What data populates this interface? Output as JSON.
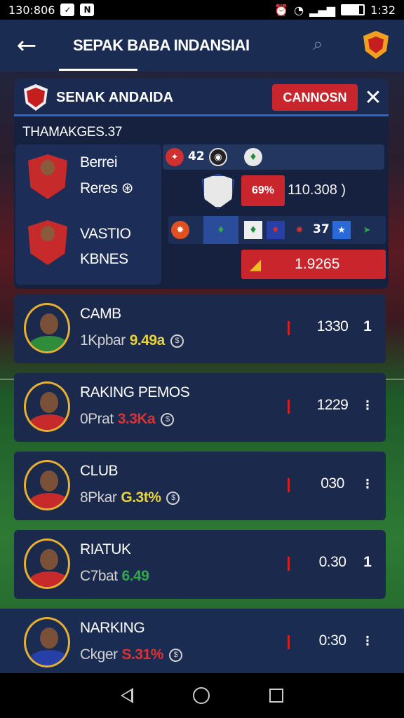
{
  "status": {
    "left_text": "130:806",
    "time": "1:32"
  },
  "app": {
    "title": "SEPAK BABA INDANSIAI"
  },
  "panel": {
    "title": "SENAK ANDAIDA",
    "button_label": "CANNOSN",
    "subtitle": "THAMAKGES.37",
    "players": [
      {
        "name": "Berrei"
      },
      {
        "name": "Reres"
      },
      {
        "name": "VASTIO"
      },
      {
        "name": "KBNES"
      }
    ],
    "row1_badge_text": "42",
    "odds_pct": "69%",
    "odds_value": "110.308 )",
    "row3_badge_text": "37",
    "big_value": "1.9265"
  },
  "cards": [
    {
      "title": "CAMB",
      "sub": "1Kpbar",
      "pct": "9.49a",
      "pct_color": "#e8d23a",
      "value": "1330",
      "end": "1",
      "shirt": "#2e8c3a"
    },
    {
      "title": "RAKING PEMOS",
      "sub": "0Prat",
      "pct": "3.3Ka",
      "pct_color": "#e03030",
      "value": "1229",
      "end": "⁝",
      "shirt": "#c62a2a"
    },
    {
      "title": "CLUB",
      "sub": "8Pkar",
      "pct": "G.3t%",
      "pct_color": "#e8d23a",
      "value": "030",
      "end": "⁝",
      "shirt": "#c62a2a"
    },
    {
      "title": "RIATUK",
      "sub": "C7bat",
      "pct": "6.49",
      "pct_color": "#2ea84a",
      "value": "0.30",
      "end": "1",
      "shirt": "#c62a2a"
    },
    {
      "title": "NARKING",
      "sub": "Ckger",
      "pct": "S.31%",
      "pct_color": "#e03030",
      "value": "0:30",
      "end": "⁝",
      "shirt": "#2740a8"
    }
  ],
  "icons": {
    "back": "arrow-left-icon",
    "search": "search-icon",
    "close": "close-icon"
  },
  "colors": {
    "accent_red": "#c8262c",
    "header_blue": "#1a2c52"
  }
}
